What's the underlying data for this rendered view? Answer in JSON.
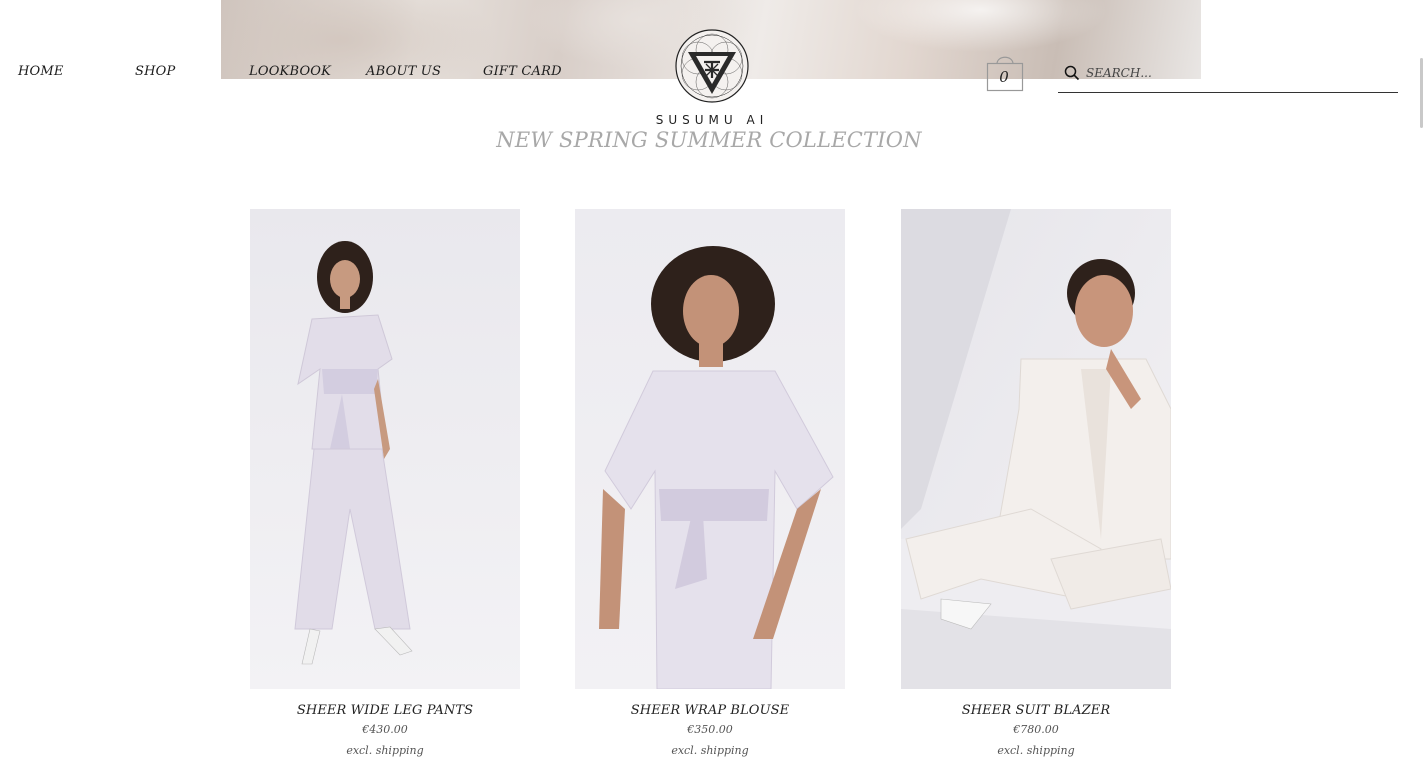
{
  "nav": {
    "items": [
      {
        "label": "HOME"
      },
      {
        "label": "SHOP"
      },
      {
        "label": "LOOKBOOK"
      },
      {
        "label": "ABOUT US"
      },
      {
        "label": "GIFT CARD"
      }
    ]
  },
  "brand": {
    "name": "SUSUMU AI",
    "logo_icon": "triangle-mandala-logo"
  },
  "cart": {
    "count": "0",
    "icon": "shopping-bag-icon"
  },
  "search": {
    "placeholder": "SEARCH...",
    "value": "",
    "icon": "search-icon"
  },
  "main": {
    "title": "NEW SPRING SUMMER COLLECTION"
  },
  "products": [
    {
      "name": "SHEER WIDE LEG PANTS",
      "price": "€430.00",
      "shipping_note": "excl. shipping",
      "image": "model-sheer-wide-leg-pants-photo"
    },
    {
      "name": "SHEER WRAP BLOUSE",
      "price": "€350.00",
      "shipping_note": "excl. shipping",
      "image": "model-sheer-wrap-blouse-photo"
    },
    {
      "name": "SHEER SUIT BLAZER",
      "price": "€780.00",
      "shipping_note": "excl. shipping",
      "image": "model-sheer-suit-blazer-photo"
    }
  ],
  "colors": {
    "title": "#a8a8a8",
    "text": "#222222",
    "background": "#ffffff"
  }
}
